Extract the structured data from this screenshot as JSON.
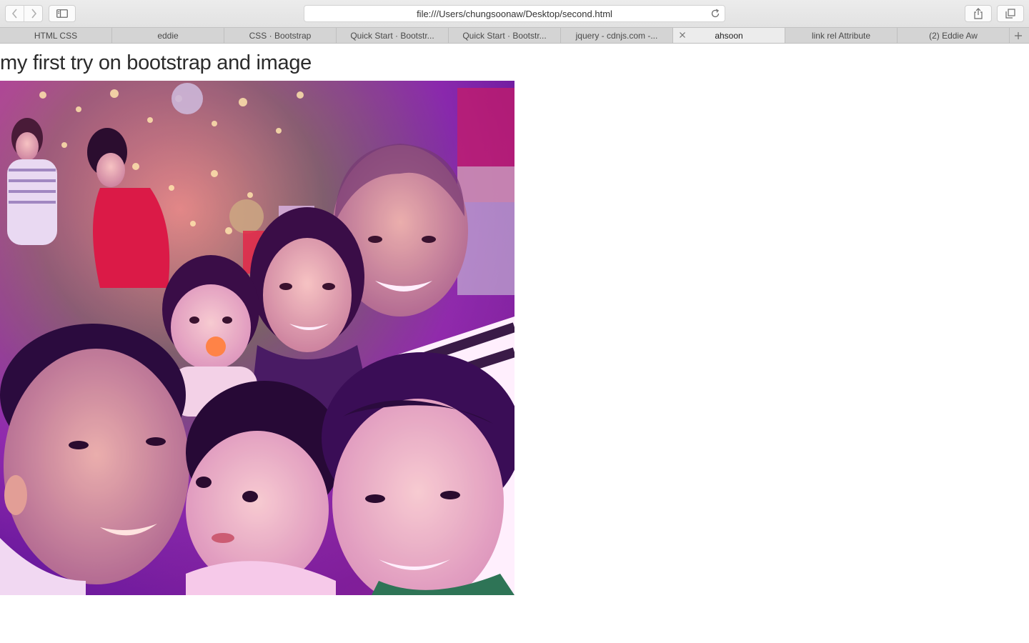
{
  "browser": {
    "address_url": "file:///Users/chungsoonaw/Desktop/second.html",
    "tabs": [
      {
        "label": "HTML CSS",
        "active": false
      },
      {
        "label": "eddie",
        "active": false
      },
      {
        "label": "CSS · Bootstrap",
        "active": false
      },
      {
        "label": "Quick Start · Bootstr...",
        "active": false
      },
      {
        "label": "Quick Start · Bootstr...",
        "active": false
      },
      {
        "label": "jquery - cdnjs.com -...",
        "active": false
      },
      {
        "label": "ahsoon",
        "active": true
      },
      {
        "label": "link rel Attribute",
        "active": false
      },
      {
        "label": "(2) Eddie Aw",
        "active": false
      }
    ],
    "icons": {
      "back": "chevron-left-icon",
      "forward": "chevron-right-icon",
      "sidebar": "sidebar-icon",
      "reload": "reload-icon",
      "share": "share-icon",
      "tabs_overview": "tabs-overview-icon",
      "new_tab": "plus-icon",
      "close_tab": "close-icon"
    }
  },
  "page": {
    "heading": "my first try on bootstrap and image"
  }
}
